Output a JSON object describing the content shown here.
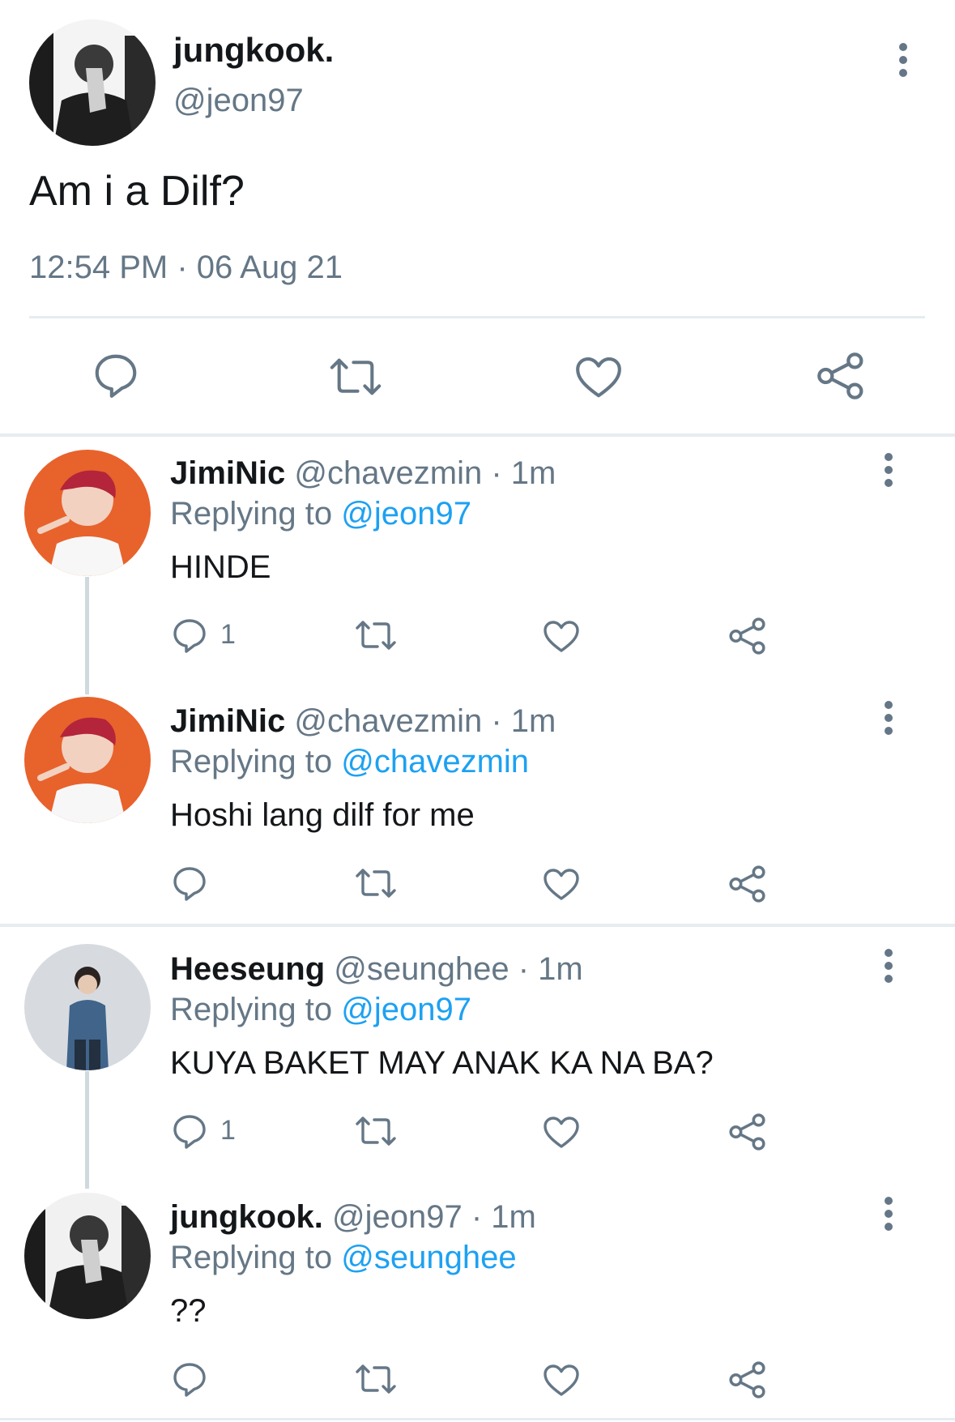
{
  "main_tweet": {
    "display_name": "jungkook.",
    "handle": "@jeon97",
    "text": "Am i a Dilf?",
    "timestamp": "12:54 PM · 06 Aug 21",
    "actions": [
      "reply-icon",
      "retweet-icon",
      "like-icon",
      "share-icon"
    ]
  },
  "replies": [
    {
      "display_name": "JimiNic",
      "handle": "@chavezmin",
      "time": "· 1m",
      "replying_prefix": "Replying to",
      "replying_to": "@jeon97",
      "text": "HINDE",
      "reply_count": "1",
      "avatar_color": "#e8622c"
    },
    {
      "display_name": "JimiNic",
      "handle": "@chavezmin",
      "time": "· 1m",
      "replying_prefix": "Replying to",
      "replying_to": "@chavezmin",
      "text": "Hoshi lang dilf for me",
      "reply_count": "",
      "avatar_color": "#e8622c"
    },
    {
      "display_name": "Heeseung",
      "handle": "@seunghee",
      "time": "· 1m",
      "replying_prefix": "Replying to",
      "replying_to": "@jeon97",
      "text": "KUYA BAKET MAY ANAK KA NA BA?",
      "reply_count": "1",
      "avatar_color": "#d7dbe0"
    },
    {
      "display_name": "jungkook.",
      "handle": "@jeon97",
      "time": "· 1m",
      "replying_prefix": "Replying to",
      "replying_to": "@seunghee",
      "text": "??",
      "reply_count": "",
      "avatar_color": "#f1f1f1"
    }
  ],
  "colors": {
    "text": "#14171a",
    "secondary": "#657786",
    "link": "#1da1f2",
    "divider": "#e6ecf0"
  }
}
